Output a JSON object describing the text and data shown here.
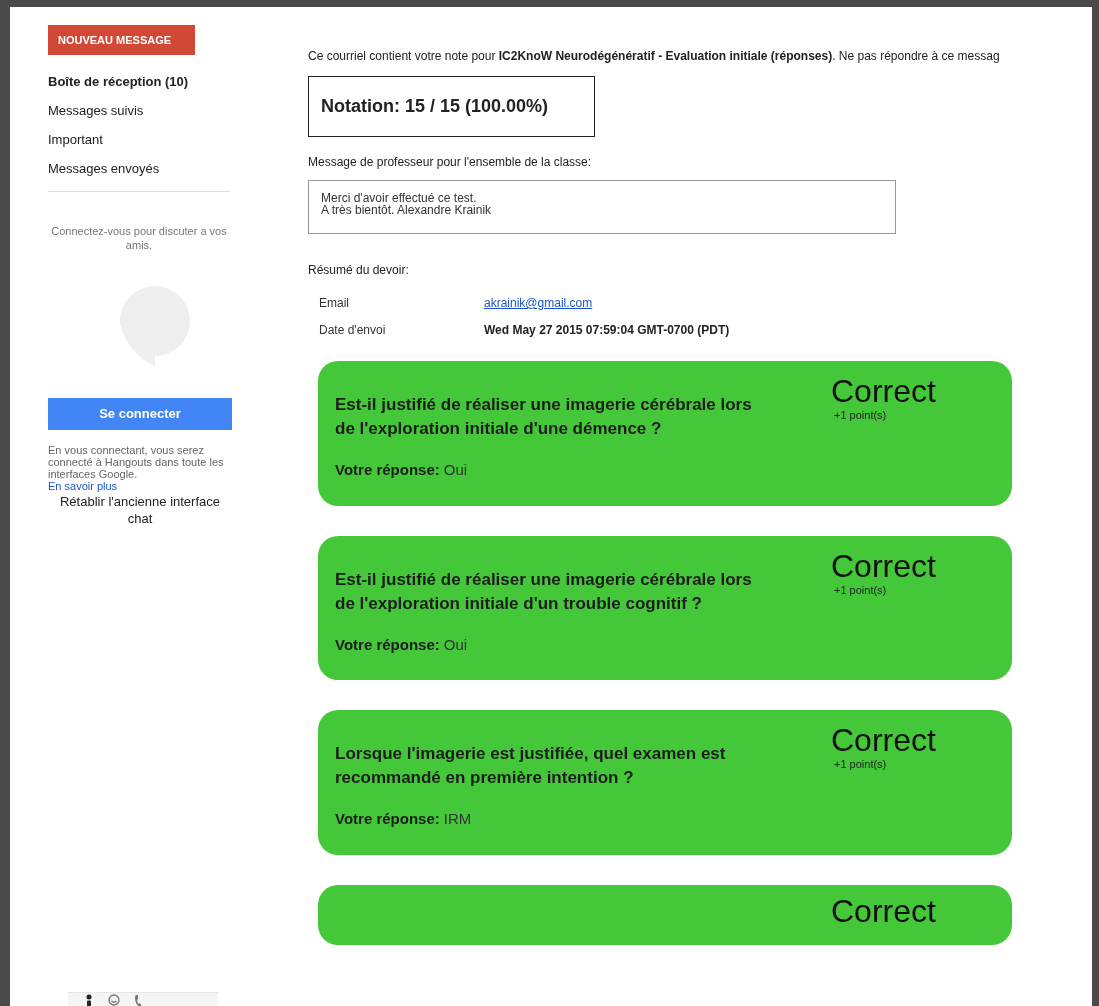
{
  "sidebar": {
    "compose_button": "NOUVEAU MESSAGE",
    "folders": [
      {
        "label": "Boîte de réception (10)",
        "selected": true
      },
      {
        "label": "Messages suivis",
        "selected": false
      },
      {
        "label": "Important",
        "selected": false
      },
      {
        "label": "Messages envoyés",
        "selected": false
      }
    ],
    "chat": {
      "prompt": "Connectez-vous pour discuter a vos amis.",
      "connect_button": "Se connecter",
      "notice": "En vous connectant, vous serez connecté à Hangouts dans toute les interfaces Google.",
      "learn_more": "En savoir plus",
      "restore_link": "Rétablir l'ancienne interface chat"
    }
  },
  "message": {
    "intro": "Ce courriel contient votre note pour **IC2KnoW Neurodégénératif - Evaluation initiale (réponses)**. Ne pas répondre à ce messag",
    "grade": "Notation: 15 / 15 (100.00%)",
    "teacher_label": "Message de professeur pour l'ensemble de la classe:",
    "teacher_message": [
      "Merci d'avoir effectué ce test.",
      "A très bientôt. Alexandre Krainik"
    ],
    "summary_label": "Résumé du devoir:",
    "summary": [
      {
        "label": "Email",
        "value": "akrainik@gmail.com",
        "kind": "link"
      },
      {
        "label": "Date d'envoi",
        "value": "Wed May 27 2015 07:59:04 GMT-0700 (PDT)",
        "kind": "text"
      }
    ],
    "questions": [
      {
        "question": "Est-il justifié de réaliser une imagerie cérébrale lors de l'exploration initiale d'une démence ?",
        "answer_label": "Votre réponse:",
        "answer": "Oui",
        "status": "Correct",
        "points": "+1 point(s)"
      },
      {
        "question": "Est-il justifié de réaliser une imagerie cérébrale lors de l'exploration initiale d'un trouble cognitif ?",
        "answer_label": "Votre réponse:",
        "answer": "Oui",
        "status": "Correct",
        "points": "+1 point(s)"
      },
      {
        "question": "Lorsque l'imagerie est justifiée, quel examen est recommandé en première intention ?",
        "answer_label": "Votre réponse:",
        "answer": "IRM",
        "status": "Correct",
        "points": "+1 point(s)"
      },
      {
        "status": "Correct"
      }
    ]
  }
}
